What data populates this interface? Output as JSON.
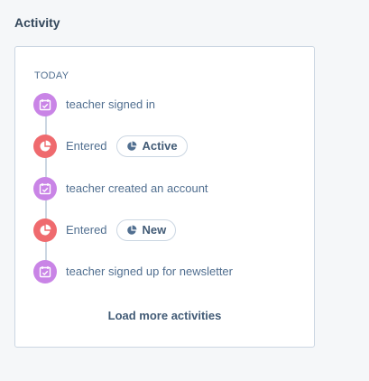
{
  "section": {
    "title": "Activity"
  },
  "timeline": {
    "day_label": "TODAY",
    "activities": [
      {
        "icon": "calendar-check-icon",
        "text": "teacher signed in"
      },
      {
        "icon": "pie-chart-icon",
        "text": "Entered",
        "pill": {
          "icon": "pie-chart-icon",
          "label": "Active"
        }
      },
      {
        "icon": "calendar-check-icon",
        "text": "teacher created an account"
      },
      {
        "icon": "pie-chart-icon",
        "text": "Entered",
        "pill": {
          "icon": "pie-chart-icon",
          "label": "New"
        }
      },
      {
        "icon": "calendar-check-icon",
        "text": "teacher signed up for newsletter"
      }
    ],
    "load_more_label": "Load more activities"
  },
  "colors": {
    "calendar_icon_bg": "#c984e6",
    "pie_icon_bg": "#ef6a6e",
    "card_border": "#cbd6e2",
    "text": "#516f90"
  }
}
